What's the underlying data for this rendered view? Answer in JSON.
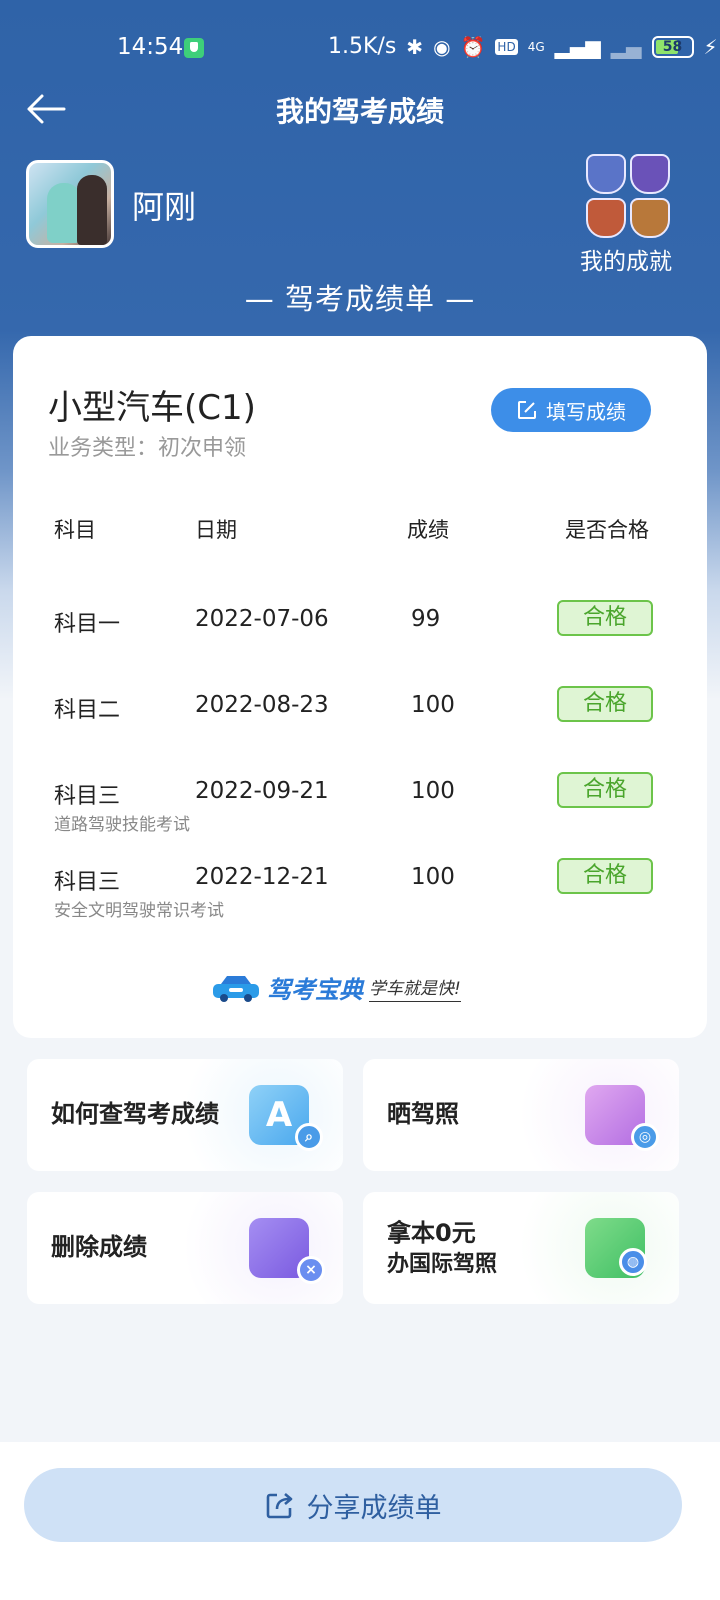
{
  "status_bar": {
    "time": "14:54",
    "speed": "1.5K/s",
    "battery": "58",
    "network": "4G",
    "hd": "HD"
  },
  "nav": {
    "title": "我的驾考成绩"
  },
  "profile": {
    "name": "阿刚",
    "achievements_label": "我的成就"
  },
  "section_title": "— 驾考成绩单 —",
  "card": {
    "car_type": "小型汽车(C1)",
    "business_type": "业务类型：初次申领",
    "fill_button": "填写成绩",
    "headers": {
      "subject": "科目",
      "date": "日期",
      "score": "成绩",
      "pass": "是否合格"
    },
    "rows": [
      {
        "subject": "科目一",
        "note": "",
        "date": "2022-07-06",
        "score": "99",
        "pass": "合格"
      },
      {
        "subject": "科目二",
        "note": "",
        "date": "2022-08-23",
        "score": "100",
        "pass": "合格"
      },
      {
        "subject": "科目三",
        "note": "道路驾驶技能考试",
        "date": "2022-09-21",
        "score": "100",
        "pass": "合格"
      },
      {
        "subject": "科目三",
        "note": "安全文明驾驶常识考试",
        "date": "2022-12-21",
        "score": "100",
        "pass": "合格"
      }
    ],
    "brand_name": "驾考宝典",
    "brand_slogan": "学车就是快!"
  },
  "tiles": {
    "check_score": "如何查驾考成绩",
    "show_license": "晒驾照",
    "delete_score": "删除成绩",
    "intl_license_line1": "拿本0元",
    "intl_license_line2": "办国际驾照"
  },
  "share_button": "分享成绩单",
  "colors": {
    "header_blue": "#3568ad",
    "accent_blue": "#3d8ee8",
    "pass_green": "#4aa52c"
  }
}
